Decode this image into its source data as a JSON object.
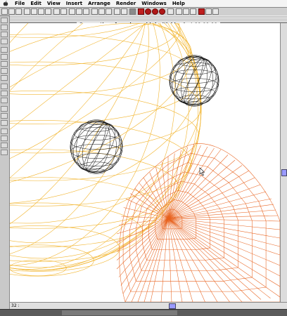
{
  "menubar": {
    "items": [
      "File",
      "Edit",
      "View",
      "Insert",
      "Arrange",
      "Render",
      "Windows",
      "Help"
    ]
  },
  "window": {
    "title": "Perspective of ray dream bird with hier:1 at 00:00:00"
  },
  "status": {
    "zoom": "32 :"
  },
  "colors": {
    "large_sphere": "#f2b632",
    "cone": "#e8621e",
    "small_spheres": "#111111",
    "scrollbar_thumb": "#9a9aff"
  },
  "icons": {
    "apple": "apple-icon",
    "render_spheres": "render-sphere-icon"
  }
}
